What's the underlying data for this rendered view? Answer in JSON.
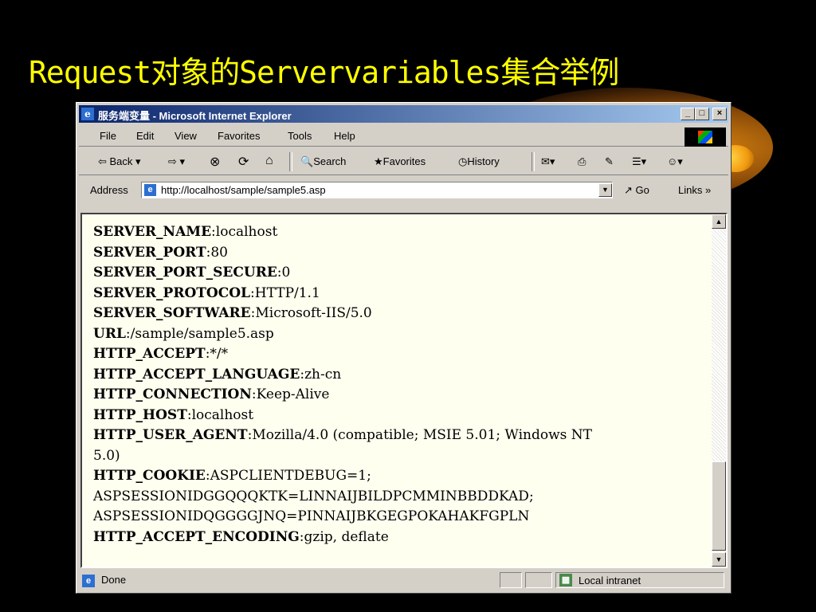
{
  "slide": {
    "title": "Request对象的Servervariables集合举例"
  },
  "window": {
    "title": "服务端变量 - Microsoft Internet Explorer",
    "buttons": {
      "minimize": "_",
      "maximize": "□",
      "close": "×"
    }
  },
  "menu": {
    "items": [
      "File",
      "Edit",
      "View",
      "Favorites",
      "Tools",
      "Help"
    ]
  },
  "toolbar": {
    "back": "⇦ Back ▾",
    "forward": "⇨ ▾",
    "stop": "⊗",
    "refresh": "⟳",
    "home": "⌂",
    "search": "Search",
    "favorites": "Favorites",
    "history": "History"
  },
  "address": {
    "label": "Address",
    "url": "http://localhost/sample/sample5.asp",
    "go": "Go",
    "links": "Links »"
  },
  "content": {
    "lines": [
      {
        "key": "SERVER_NAME",
        "value": "localhost"
      },
      {
        "key": "SERVER_PORT",
        "value": "80"
      },
      {
        "key": "SERVER_PORT_SECURE",
        "value": "0"
      },
      {
        "key": "SERVER_PROTOCOL",
        "value": "HTTP/1.1"
      },
      {
        "key": "SERVER_SOFTWARE",
        "value": "Microsoft-IIS/5.0"
      },
      {
        "key": "URL",
        "value": "/sample/sample5.asp"
      },
      {
        "key": "HTTP_ACCEPT",
        "value": "*/*"
      },
      {
        "key": "HTTP_ACCEPT_LANGUAGE",
        "value": "zh-cn"
      },
      {
        "key": "HTTP_CONNECTION",
        "value": "Keep-Alive"
      },
      {
        "key": "HTTP_HOST",
        "value": "localhost"
      },
      {
        "key": "HTTP_USER_AGENT",
        "value": "Mozilla/4.0 (compatible; MSIE 5.01; Windows NT"
      },
      {
        "key": "",
        "value": "5.0)"
      },
      {
        "key": "HTTP_COOKIE",
        "value": "ASPCLIENTDEBUG=1;"
      },
      {
        "key": "",
        "value": "ASPSESSIONIDGGQQQKTK=LINNAIJBILDPCMMINBBDDKAD;"
      },
      {
        "key": "",
        "value": "ASPSESSIONIDQGGGGJNQ=PINNAIJBKGEGPOKAHAKFGPLN"
      },
      {
        "key": "HTTP_ACCEPT_ENCODING",
        "value": "gzip, deflate"
      }
    ]
  },
  "status": {
    "text": "Done",
    "zone": "Local intranet"
  }
}
